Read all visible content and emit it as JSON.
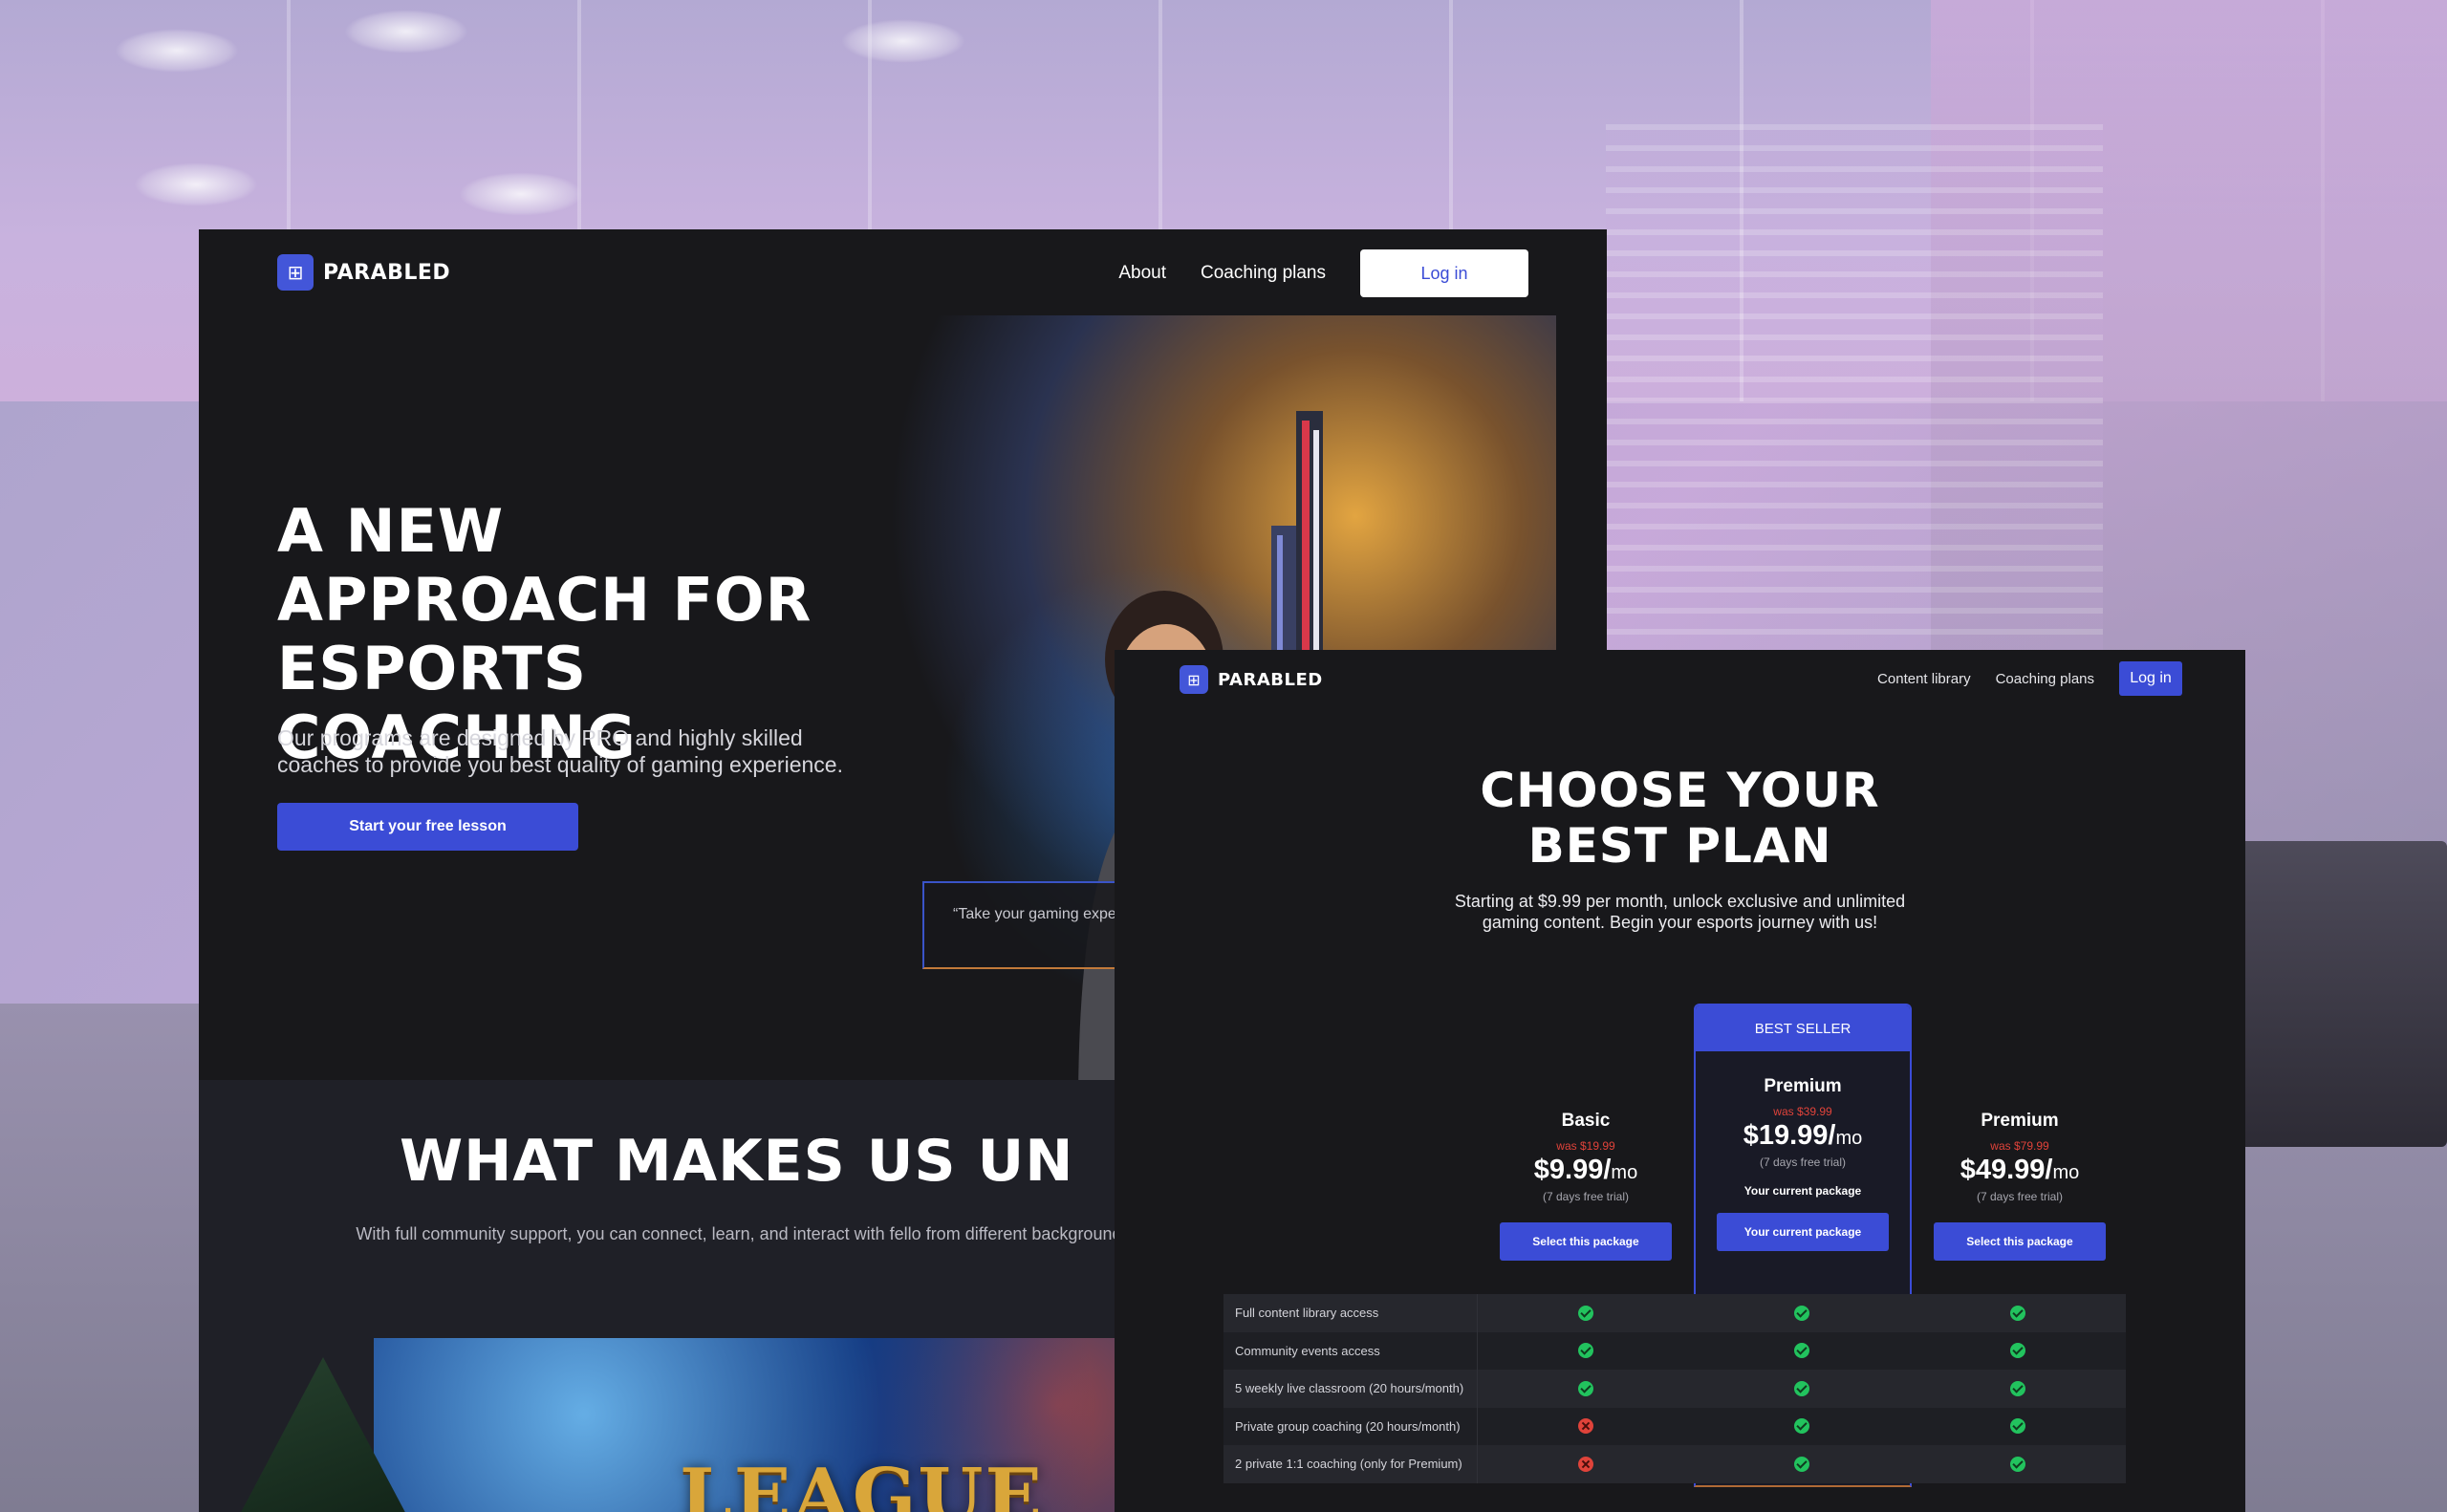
{
  "brand": {
    "name": "PARABLED",
    "logo_icon": "gamepad-icon"
  },
  "landing": {
    "nav": {
      "about": "About",
      "coaching_plans": "Coaching plans",
      "login": "Log in"
    },
    "hero": {
      "title": "A NEW APPROACH FOR ESPORTS COACHING",
      "subtitle": "Our programs are designed by PRO and highly skilled coaches to provide you best quality of gaming experience.",
      "cta": "Start your free lesson",
      "quote": "“Take your gaming expe from industry experts al"
    },
    "section2": {
      "title": "WHAT MAKES US UN",
      "subtitle": "With full community support, you can connect, learn, and interact with fello from different background and experience.",
      "banner_text": "LEAGUE"
    }
  },
  "pricing": {
    "nav": {
      "content_library": "Content library",
      "coaching_plans": "Coaching plans",
      "login": "Log in"
    },
    "title": "CHOOSE YOUR BEST PLAN",
    "subtitle": "Starting at $9.99 per month, unlock exclusive and unlimited gaming content. Begin your esports journey with us!",
    "best_seller": "BEST SELLER",
    "plans": [
      {
        "name": "Basic",
        "was": "was $19.99",
        "price": "$9.99/",
        "unit": "mo",
        "trial": "(7 days free trial)",
        "current": "",
        "button": "Select this package"
      },
      {
        "name": "Premium",
        "was": "was $39.99",
        "price": "$19.99/",
        "unit": "mo",
        "trial": "(7 days free trial)",
        "current": "Your current package",
        "button": "Your current package"
      },
      {
        "name": "Premium",
        "was": "was $79.99",
        "price": "$49.99/",
        "unit": "mo",
        "trial": "(7 days free trial)",
        "current": "",
        "button": "Select this package"
      }
    ],
    "features": [
      {
        "label": "Full content library access",
        "values": [
          true,
          true,
          true
        ]
      },
      {
        "label": "Community events access",
        "values": [
          true,
          true,
          true
        ]
      },
      {
        "label": "5 weekly live classroom (20 hours/month)",
        "values": [
          true,
          true,
          true
        ]
      },
      {
        "label": "Private group coaching (20 hours/month)",
        "values": [
          false,
          true,
          true
        ]
      },
      {
        "label": "2 private 1:1 coaching  (only for Premium)",
        "values": [
          false,
          true,
          true
        ]
      }
    ],
    "colors": {
      "accent": "#3b4cd6",
      "check": "#22c35e",
      "cross": "#e0433a",
      "was_price": "#e0433a"
    }
  }
}
